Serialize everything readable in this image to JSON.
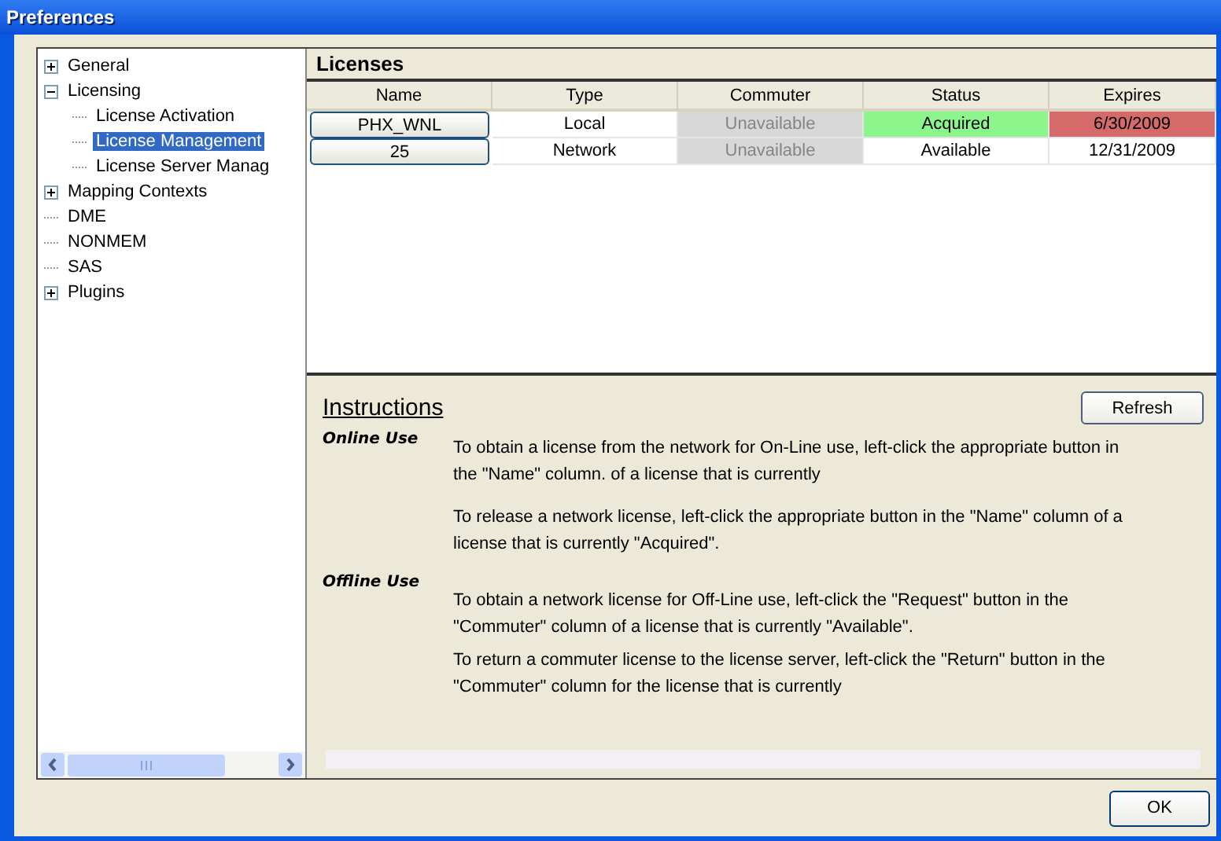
{
  "window": {
    "title": "Preferences"
  },
  "tree": [
    {
      "label": "General",
      "expanded": false,
      "selected": false
    },
    {
      "label": "Licensing",
      "expanded": true,
      "selected": false,
      "children": [
        {
          "label": "License Activation",
          "selected": false
        },
        {
          "label": "License Management",
          "selected": true
        },
        {
          "label": "License Server Manag",
          "selected": false
        }
      ]
    },
    {
      "label": "Mapping Contexts",
      "expanded": false,
      "selected": false
    },
    {
      "label": "DME",
      "selected": false
    },
    {
      "label": "NONMEM",
      "selected": false
    },
    {
      "label": "SAS",
      "selected": false
    },
    {
      "label": "Plugins",
      "expanded": false,
      "selected": false
    }
  ],
  "licenses": {
    "title": "Licenses",
    "columns": [
      "Name",
      "Type",
      "Commuter",
      "Status",
      "Expires"
    ],
    "rows": [
      {
        "name": "PHX_WNL",
        "type": "Local",
        "commuter": {
          "text": "Unavailable",
          "disabled": true
        },
        "status": {
          "text": "Acquired",
          "color": "#8cf58c"
        },
        "expires": {
          "text": "6/30/2009",
          "color": "#d46a6a"
        }
      },
      {
        "name": "25",
        "type": "Network",
        "commuter": {
          "text": "Unavailable",
          "disabled": true
        },
        "status": {
          "text": "Available"
        },
        "expires": {
          "text": "12/31/2009"
        }
      }
    ]
  },
  "instructions": {
    "title": "Instructions",
    "refresh_button": "Refresh",
    "sections": [
      {
        "label": "Online Use",
        "paragraphs": [
          "To obtain a license from the network for On-Line use, left-click the appropriate button in the \"Name\" column. of a license that is currently",
          "To release a network license, left-click the appropriate button in the \"Name\" column of a license that is currently \"Acquired\"."
        ]
      },
      {
        "label": "Offline Use",
        "paragraphs": [
          "To obtain a network license for Off-Line use, left-click the \"Request\" button in the \"Commuter\" column of a license that is currently \"Available\".",
          "To return a commuter license to the license server, left-click the \"Return\" button in the \"Commuter\" column for the license that is currently"
        ]
      }
    ]
  },
  "ok_button": "OK"
}
